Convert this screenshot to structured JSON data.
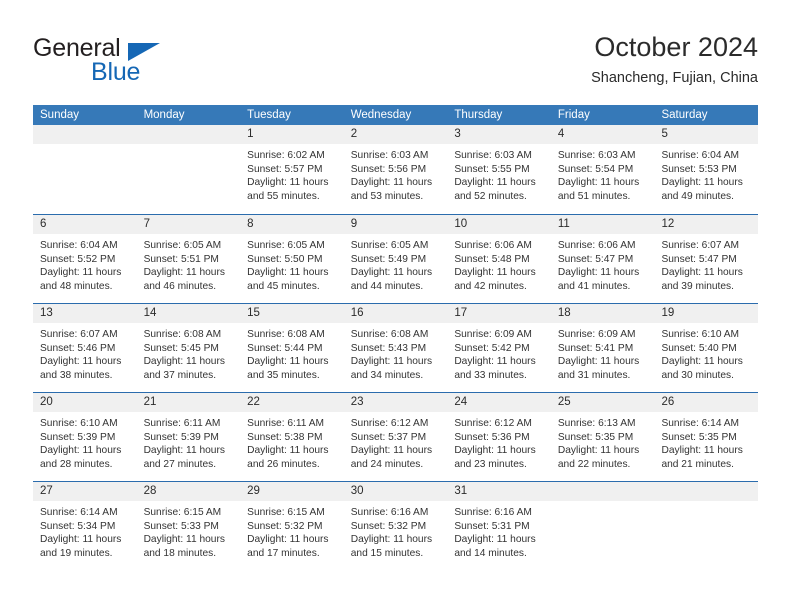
{
  "logo": {
    "word1": "General",
    "word2": "Blue",
    "triangle_color": "#1567b5",
    "word1_color": "#231f20",
    "word2_color": "#1567b5"
  },
  "header": {
    "title": "October 2024",
    "subtitle": "Shancheng, Fujian, China"
  },
  "theme": {
    "header_bg": "#3679b8",
    "row_divider": "#2b6cad",
    "day_band_bg": "#f0f0f0",
    "text": "#333333"
  },
  "calendar": {
    "weekday_headers": [
      "Sunday",
      "Monday",
      "Tuesday",
      "Wednesday",
      "Thursday",
      "Friday",
      "Saturday"
    ],
    "weeks": [
      [
        {
          "day": "",
          "lines": []
        },
        {
          "day": "",
          "lines": []
        },
        {
          "day": "1",
          "lines": [
            "Sunrise: 6:02 AM",
            "Sunset: 5:57 PM",
            "Daylight: 11 hours",
            "and 55 minutes."
          ]
        },
        {
          "day": "2",
          "lines": [
            "Sunrise: 6:03 AM",
            "Sunset: 5:56 PM",
            "Daylight: 11 hours",
            "and 53 minutes."
          ]
        },
        {
          "day": "3",
          "lines": [
            "Sunrise: 6:03 AM",
            "Sunset: 5:55 PM",
            "Daylight: 11 hours",
            "and 52 minutes."
          ]
        },
        {
          "day": "4",
          "lines": [
            "Sunrise: 6:03 AM",
            "Sunset: 5:54 PM",
            "Daylight: 11 hours",
            "and 51 minutes."
          ]
        },
        {
          "day": "5",
          "lines": [
            "Sunrise: 6:04 AM",
            "Sunset: 5:53 PM",
            "Daylight: 11 hours",
            "and 49 minutes."
          ]
        }
      ],
      [
        {
          "day": "6",
          "lines": [
            "Sunrise: 6:04 AM",
            "Sunset: 5:52 PM",
            "Daylight: 11 hours",
            "and 48 minutes."
          ]
        },
        {
          "day": "7",
          "lines": [
            "Sunrise: 6:05 AM",
            "Sunset: 5:51 PM",
            "Daylight: 11 hours",
            "and 46 minutes."
          ]
        },
        {
          "day": "8",
          "lines": [
            "Sunrise: 6:05 AM",
            "Sunset: 5:50 PM",
            "Daylight: 11 hours",
            "and 45 minutes."
          ]
        },
        {
          "day": "9",
          "lines": [
            "Sunrise: 6:05 AM",
            "Sunset: 5:49 PM",
            "Daylight: 11 hours",
            "and 44 minutes."
          ]
        },
        {
          "day": "10",
          "lines": [
            "Sunrise: 6:06 AM",
            "Sunset: 5:48 PM",
            "Daylight: 11 hours",
            "and 42 minutes."
          ]
        },
        {
          "day": "11",
          "lines": [
            "Sunrise: 6:06 AM",
            "Sunset: 5:47 PM",
            "Daylight: 11 hours",
            "and 41 minutes."
          ]
        },
        {
          "day": "12",
          "lines": [
            "Sunrise: 6:07 AM",
            "Sunset: 5:47 PM",
            "Daylight: 11 hours",
            "and 39 minutes."
          ]
        }
      ],
      [
        {
          "day": "13",
          "lines": [
            "Sunrise: 6:07 AM",
            "Sunset: 5:46 PM",
            "Daylight: 11 hours",
            "and 38 minutes."
          ]
        },
        {
          "day": "14",
          "lines": [
            "Sunrise: 6:08 AM",
            "Sunset: 5:45 PM",
            "Daylight: 11 hours",
            "and 37 minutes."
          ]
        },
        {
          "day": "15",
          "lines": [
            "Sunrise: 6:08 AM",
            "Sunset: 5:44 PM",
            "Daylight: 11 hours",
            "and 35 minutes."
          ]
        },
        {
          "day": "16",
          "lines": [
            "Sunrise: 6:08 AM",
            "Sunset: 5:43 PM",
            "Daylight: 11 hours",
            "and 34 minutes."
          ]
        },
        {
          "day": "17",
          "lines": [
            "Sunrise: 6:09 AM",
            "Sunset: 5:42 PM",
            "Daylight: 11 hours",
            "and 33 minutes."
          ]
        },
        {
          "day": "18",
          "lines": [
            "Sunrise: 6:09 AM",
            "Sunset: 5:41 PM",
            "Daylight: 11 hours",
            "and 31 minutes."
          ]
        },
        {
          "day": "19",
          "lines": [
            "Sunrise: 6:10 AM",
            "Sunset: 5:40 PM",
            "Daylight: 11 hours",
            "and 30 minutes."
          ]
        }
      ],
      [
        {
          "day": "20",
          "lines": [
            "Sunrise: 6:10 AM",
            "Sunset: 5:39 PM",
            "Daylight: 11 hours",
            "and 28 minutes."
          ]
        },
        {
          "day": "21",
          "lines": [
            "Sunrise: 6:11 AM",
            "Sunset: 5:39 PM",
            "Daylight: 11 hours",
            "and 27 minutes."
          ]
        },
        {
          "day": "22",
          "lines": [
            "Sunrise: 6:11 AM",
            "Sunset: 5:38 PM",
            "Daylight: 11 hours",
            "and 26 minutes."
          ]
        },
        {
          "day": "23",
          "lines": [
            "Sunrise: 6:12 AM",
            "Sunset: 5:37 PM",
            "Daylight: 11 hours",
            "and 24 minutes."
          ]
        },
        {
          "day": "24",
          "lines": [
            "Sunrise: 6:12 AM",
            "Sunset: 5:36 PM",
            "Daylight: 11 hours",
            "and 23 minutes."
          ]
        },
        {
          "day": "25",
          "lines": [
            "Sunrise: 6:13 AM",
            "Sunset: 5:35 PM",
            "Daylight: 11 hours",
            "and 22 minutes."
          ]
        },
        {
          "day": "26",
          "lines": [
            "Sunrise: 6:14 AM",
            "Sunset: 5:35 PM",
            "Daylight: 11 hours",
            "and 21 minutes."
          ]
        }
      ],
      [
        {
          "day": "27",
          "lines": [
            "Sunrise: 6:14 AM",
            "Sunset: 5:34 PM",
            "Daylight: 11 hours",
            "and 19 minutes."
          ]
        },
        {
          "day": "28",
          "lines": [
            "Sunrise: 6:15 AM",
            "Sunset: 5:33 PM",
            "Daylight: 11 hours",
            "and 18 minutes."
          ]
        },
        {
          "day": "29",
          "lines": [
            "Sunrise: 6:15 AM",
            "Sunset: 5:32 PM",
            "Daylight: 11 hours",
            "and 17 minutes."
          ]
        },
        {
          "day": "30",
          "lines": [
            "Sunrise: 6:16 AM",
            "Sunset: 5:32 PM",
            "Daylight: 11 hours",
            "and 15 minutes."
          ]
        },
        {
          "day": "31",
          "lines": [
            "Sunrise: 6:16 AM",
            "Sunset: 5:31 PM",
            "Daylight: 11 hours",
            "and 14 minutes."
          ]
        },
        {
          "day": "",
          "lines": []
        },
        {
          "day": "",
          "lines": []
        }
      ]
    ]
  }
}
